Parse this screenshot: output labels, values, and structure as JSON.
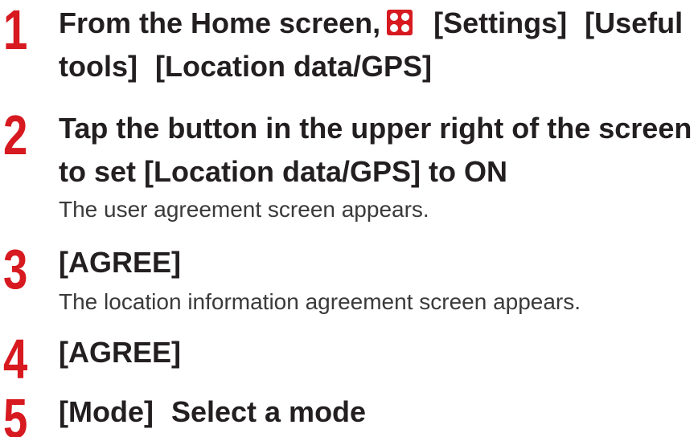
{
  "steps": [
    {
      "number": "1",
      "title_part1": "From the Home screen,",
      "icon": "apps-icon",
      "title_part2": "[Settings]",
      "title_part3": "[Useful",
      "title_line2_part1": "tools]",
      "title_line2_part2": "[Location data/GPS]"
    },
    {
      "number": "2",
      "title_line1": "Tap the button in the upper right of the screen",
      "title_line2": "to set [Location data/GPS] to ON",
      "description": "The user agreement screen appears."
    },
    {
      "number": "3",
      "title": "[AGREE]",
      "description": "The location information agreement screen appears."
    },
    {
      "number": "4",
      "title": "[AGREE]"
    },
    {
      "number": "5",
      "title_part1": "[Mode]",
      "title_part2": "Select a mode"
    }
  ],
  "colors": {
    "step_number": "#d71920",
    "title_text": "#231f20",
    "body_text": "#3a3a3a",
    "apps_icon_background": "#d71920"
  }
}
